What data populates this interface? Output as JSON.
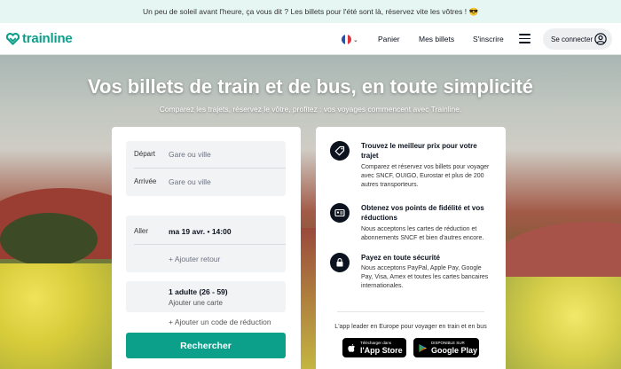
{
  "promo_banner": {
    "text": "Un peu de soleil avant l'heure, ça vous dit ? Les billets pour l'été sont là, réservez vite les vôtres ! 😎"
  },
  "header": {
    "logo_text": "trainline",
    "language": "FR",
    "nav": {
      "cart": "Panier",
      "tickets": "Mes billets",
      "signup": "S'inscrire"
    },
    "login_label": "Se connecter"
  },
  "hero": {
    "title": "Vos billets de train et de bus, en toute simplicité",
    "subtitle": "Comparez les trajets, réservez le vôtre, profitez : vos voyages commencent avec Trainline."
  },
  "search": {
    "departure_label": "Départ",
    "departure_placeholder": "Gare ou ville",
    "arrival_label": "Arrivée",
    "arrival_placeholder": "Gare ou ville",
    "outbound_label": "Aller",
    "outbound_value": "ma 19 avr. • 14:00",
    "add_return": "+ Ajouter retour",
    "passengers": "1 adulte (26 - 59)",
    "add_card": "Ajouter une carte",
    "add_discount": "+ Ajouter un code de réduction",
    "search_button": "Rechercher"
  },
  "features": [
    {
      "icon": "tag-icon",
      "title": "Trouvez le meilleur prix pour votre trajet",
      "text": "Comparez et réservez vos billets pour voyager avec SNCF, OUIGO, Eurostar et plus de 200 autres transporteurs."
    },
    {
      "icon": "loyalty-card-icon",
      "title": "Obtenez vos points de fidélité et vos réductions",
      "text": "Nous acceptons les cartes de réduction et abonnements SNCF et bien d'autres encore."
    },
    {
      "icon": "lock-icon",
      "title": "Payez en toute sécurité",
      "text": "Nous acceptons PayPal, Apple Pay, Google Pay, Visa, Amex et toutes les cartes bancaires internationales."
    }
  ],
  "app": {
    "tagline": "L'app leader en Europe pour voyager en train et en bus",
    "app_store_small": "Télécharger dans",
    "app_store_big": "l'App Store",
    "google_play_small": "DISPONIBLE SUR",
    "google_play_big": "Google Play"
  },
  "colors": {
    "brand": "#0c9f8a",
    "banner_bg": "#e6f7f3",
    "dark": "#0c131f"
  }
}
